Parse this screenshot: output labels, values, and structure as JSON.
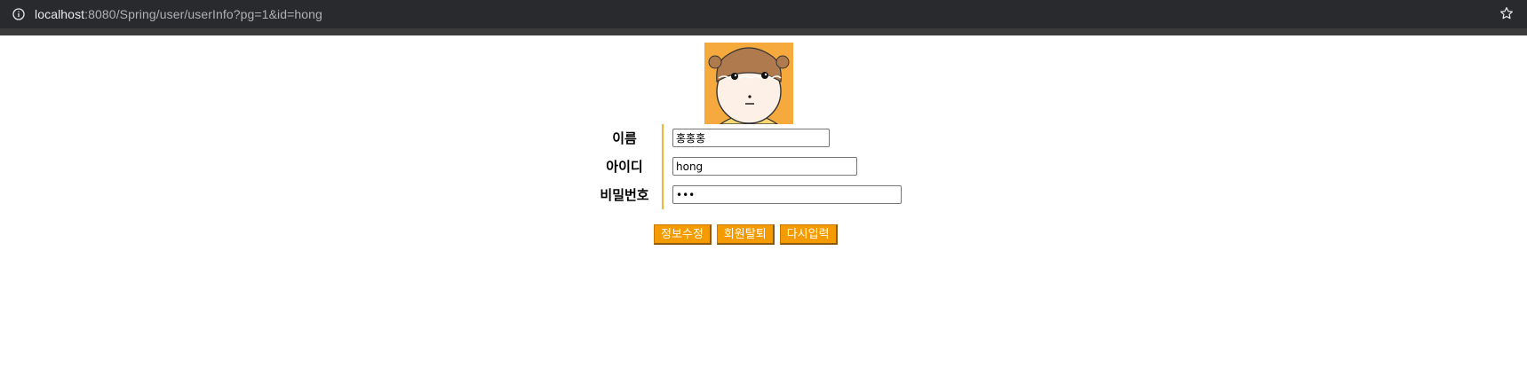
{
  "browser": {
    "url_host": "localhost",
    "url_rest": ":8080/Spring/user/userInfo?pg=1&id=hong"
  },
  "form": {
    "name_label": "이름",
    "name_value": "홍홍홍",
    "id_label": "아이디",
    "id_value": "hong",
    "password_label": "비밀번호",
    "password_value": "•••"
  },
  "buttons": {
    "update_label": "정보수정",
    "withdraw_label": "회원탈퇴",
    "reset_label": "다시입력"
  },
  "colors": {
    "button_bg": "#f59b00",
    "avatar_bg": "#f6a93c",
    "divider": "#f6b43a"
  },
  "icons": {
    "site_info": "info-circle-icon",
    "bookmark": "star-icon"
  }
}
